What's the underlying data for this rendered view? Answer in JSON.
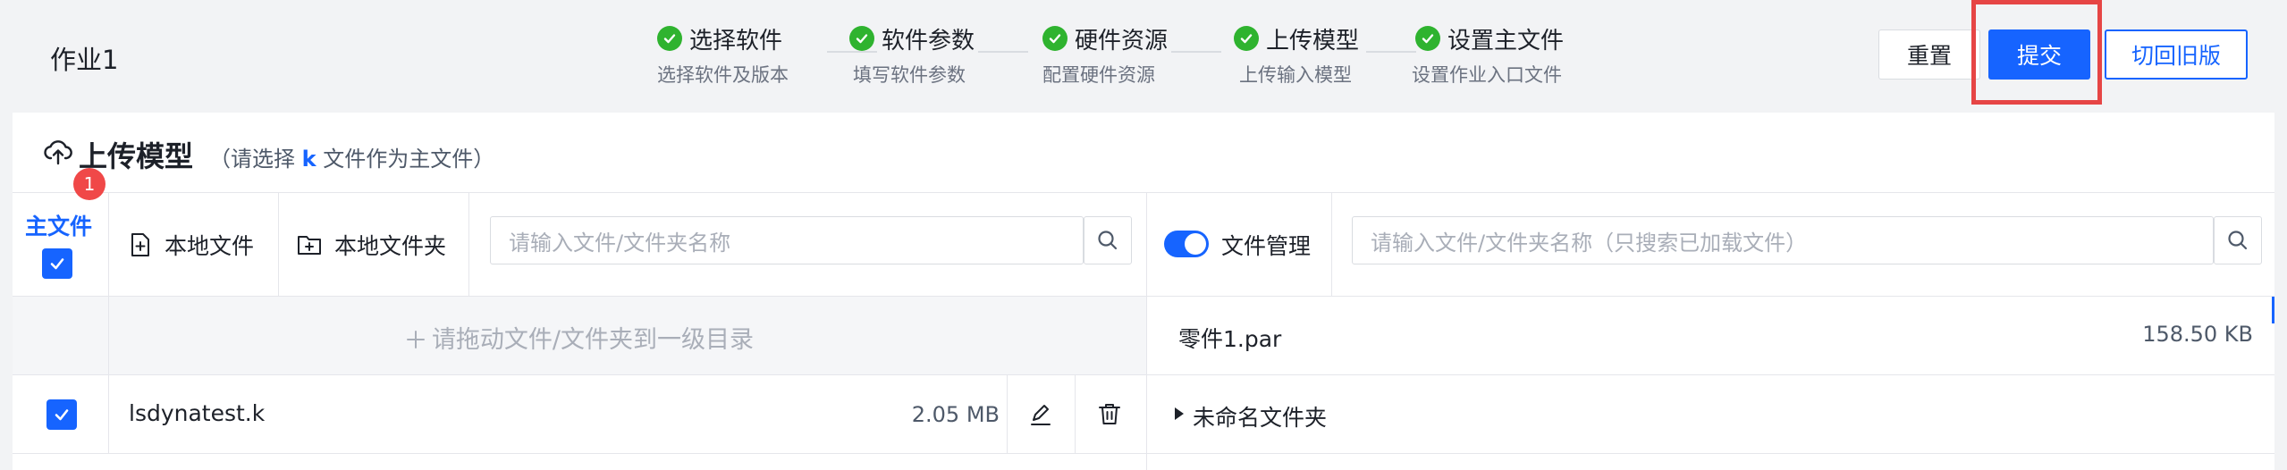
{
  "header": {
    "job_title": "作业1",
    "steps": [
      {
        "label": "选择软件",
        "sub": "选择软件及版本"
      },
      {
        "label": "软件参数",
        "sub": "填写软件参数"
      },
      {
        "label": "硬件资源",
        "sub": "配置硬件资源"
      },
      {
        "label": "上传模型",
        "sub": "上传输入模型"
      },
      {
        "label": "设置主文件",
        "sub": "设置作业入口文件"
      }
    ],
    "buttons": {
      "reset": "重置",
      "submit": "提交",
      "old_version": "切回旧版"
    }
  },
  "panel": {
    "title": "上传模型",
    "hint_prefix": "（请选择 ",
    "hint_ext": "k",
    "hint_suffix": " 文件作为主文件）",
    "toolbar": {
      "main_file_label": "主文件",
      "badge_count": "1",
      "local_file": "本地文件",
      "local_folder": "本地文件夹",
      "search_placeholder": "请输入文件/文件夹名称",
      "file_manage_label": "文件管理",
      "file_manage_on": true,
      "right_search_placeholder": "请输入文件/文件夹名称（只搜索已加载文件）"
    },
    "drop_hint": "请拖动文件/文件夹到一级目录",
    "files": [
      {
        "name": "lsdynatest.k",
        "size": "2.05 MB",
        "checked": true
      }
    ],
    "file_manager": [
      {
        "name": "零件1.par",
        "size": "158.50 KB"
      },
      {
        "name": "未命名文件夹",
        "type": "folder"
      }
    ]
  },
  "colors": {
    "primary": "#1664ff",
    "success": "#2fb32f",
    "danger": "#f04848",
    "highlight": "#e64545"
  }
}
